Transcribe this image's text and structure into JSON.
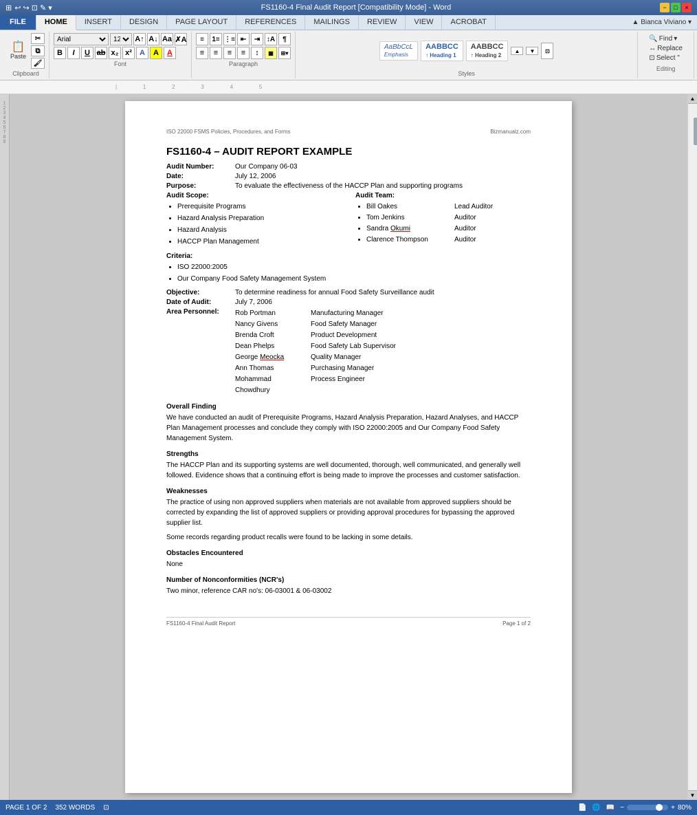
{
  "titleBar": {
    "title": "FS1160-4 Final Audit Report [Compatibility Mode] - Word",
    "leftIcons": [
      "⊞",
      "↩",
      "↪",
      "⊡",
      "✎",
      "⧉"
    ]
  },
  "ribbon": {
    "tabs": [
      {
        "label": "FILE",
        "id": "file",
        "active": false,
        "isFile": true
      },
      {
        "label": "HOME",
        "id": "home",
        "active": true
      },
      {
        "label": "INSERT",
        "id": "insert",
        "active": false
      },
      {
        "label": "DESIGN",
        "id": "design",
        "active": false
      },
      {
        "label": "PAGE LAYOUT",
        "id": "page-layout",
        "active": false
      },
      {
        "label": "REFERENCES",
        "id": "references",
        "active": false
      },
      {
        "label": "MAILINGS",
        "id": "mailings",
        "active": false
      },
      {
        "label": "REVIEW",
        "id": "review",
        "active": false
      },
      {
        "label": "VIEW",
        "id": "view",
        "active": false
      },
      {
        "label": "ACROBAT",
        "id": "acrobat",
        "active": false
      }
    ],
    "clipboard": {
      "label": "Clipboard",
      "paste": "Paste"
    },
    "font": {
      "label": "Font",
      "family": "Arial",
      "size": "12",
      "boldBtn": "B",
      "italicBtn": "I",
      "underlineBtn": "U"
    },
    "paragraph": {
      "label": "Paragraph"
    },
    "styles": {
      "label": "Styles",
      "items": [
        {
          "label": "AaBbCcL",
          "name": "Emphasis"
        },
        {
          "label": "AABBCC",
          "name": "Heading 1",
          "bold": true
        },
        {
          "label": "AABBCC",
          "name": "Heading 2",
          "bold": true
        }
      ]
    },
    "editing": {
      "label": "Editing",
      "find": "Find",
      "replace": "Replace",
      "select": "Select \""
    }
  },
  "document": {
    "headerLeft": "ISO 22000 FSMS Policies, Procedures, and Forms",
    "headerRight": "Bizmanualz.com",
    "title": "FS1160-4 – AUDIT REPORT EXAMPLE",
    "auditNumber": {
      "label": "Audit Number:",
      "value": "Our Company 06-03"
    },
    "date": {
      "label": "Date:",
      "value": "July 12, 2006"
    },
    "purpose": {
      "label": "Purpose:",
      "value": "To evaluate the effectiveness of the HACCP Plan and supporting programs"
    },
    "auditScope": {
      "label": "Audit Scope:",
      "items": [
        "Prerequisite Programs",
        "Hazard Analysis Preparation",
        "Hazard Analysis",
        "HACCP Plan Management"
      ]
    },
    "auditTeam": {
      "label": "Audit Team:",
      "members": [
        {
          "name": "Bill Oakes",
          "role": "Lead Auditor"
        },
        {
          "name": "Tom Jenkins",
          "role": "Auditor"
        },
        {
          "name": "Sandra Okumi",
          "role": "Auditor",
          "underline": true
        },
        {
          "name": "Clarence Thompson",
          "role": "Auditor"
        }
      ]
    },
    "criteria": {
      "label": "Criteria:",
      "items": [
        "ISO 22000:2005",
        "Our Company Food Safety Management System"
      ]
    },
    "objective": {
      "label": "Objective:",
      "value": "To determine readiness for annual Food Safety Surveillance audit"
    },
    "dateOfAudit": {
      "label": "Date of Audit:",
      "value": "July 7, 2006"
    },
    "areaPersonnel": {
      "label": "Area Personnel:",
      "rows": [
        {
          "name": "Rob Portman",
          "title": "Manufacturing Manager"
        },
        {
          "name": "Nancy Givens",
          "title": "Food Safety Manager"
        },
        {
          "name": "Brenda Croft",
          "title": "Product Development"
        },
        {
          "name": "Dean Phelps",
          "title": "Food Safety Lab Supervisor"
        },
        {
          "name": "George Meocka",
          "title": "Quality Manager",
          "underline": true
        },
        {
          "name": "Ann Thomas",
          "title": "Purchasing Manager"
        },
        {
          "name": "Mohammad Chowdhury",
          "title": "Process Engineer"
        }
      ]
    },
    "overallFinding": {
      "heading": "Overall Finding",
      "text": "We have conducted an audit of Prerequisite Programs, Hazard Analysis Preparation, Hazard Analyses, and HACCP Plan Management processes and conclude they comply with ISO 22000:2005 and Our Company Food Safety Management System."
    },
    "strengths": {
      "heading": "Strengths",
      "text": "The HACCP Plan and its supporting systems are well documented, thorough, well communicated, and generally well followed. Evidence shows that a continuing effort is being made to improve the processes and customer satisfaction."
    },
    "weaknesses": {
      "heading": "Weaknesses",
      "para1": "The practice of using non approved suppliers when materials are not available from approved suppliers should be corrected by expanding the list of approved suppliers or providing approval procedures for bypassing the approved supplier list.",
      "para2": "Some records regarding product recalls were found to be lacking in some details."
    },
    "obstacles": {
      "heading": "Obstacles Encountered",
      "text": "None"
    },
    "nonconformities": {
      "heading": "Number of Nonconformities (NCR's)",
      "text": "Two minor, reference CAR no's: 06-03001 & 06-03002"
    },
    "footer": {
      "left": "FS1160-4 Final Audit Report",
      "right": "Page 1 of 2"
    }
  },
  "statusBar": {
    "pageInfo": "PAGE 1 OF 2",
    "wordCount": "352 WORDS",
    "viewMode": "80%"
  }
}
